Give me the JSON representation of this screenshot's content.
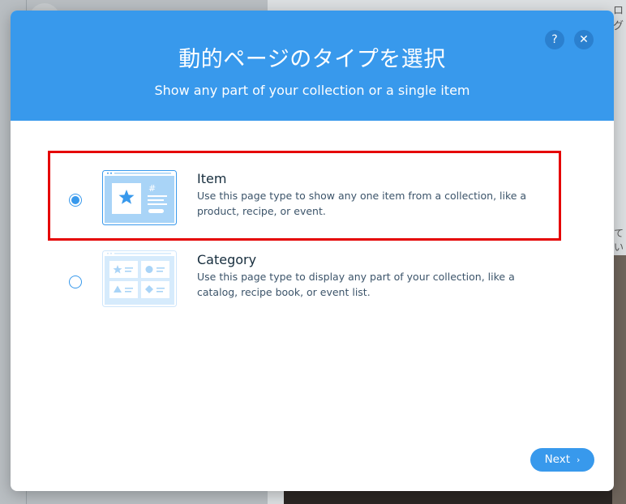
{
  "background": {
    "top_text": "ログ",
    "side_text": "てい"
  },
  "dialog": {
    "title": "動的ページのタイプを選択",
    "subtitle": "Show any part of your collection or a single item",
    "help_label": "?",
    "close_label": "✕",
    "next_label": "Next",
    "next_chevron": "›"
  },
  "options": [
    {
      "title": "Item",
      "description": "Use this page type to show any one item from a collection, like a product, recipe, or event.",
      "selected": true
    },
    {
      "title": "Category",
      "description": "Use this page type to display any part of your collection, like a catalog, recipe book, or event list.",
      "selected": false
    }
  ],
  "item_thumb_hash": "#",
  "colors": {
    "accent": "#3899ec",
    "highlight": "#e50000",
    "title_text": "#162d3d",
    "body_text": "#3c546a"
  }
}
